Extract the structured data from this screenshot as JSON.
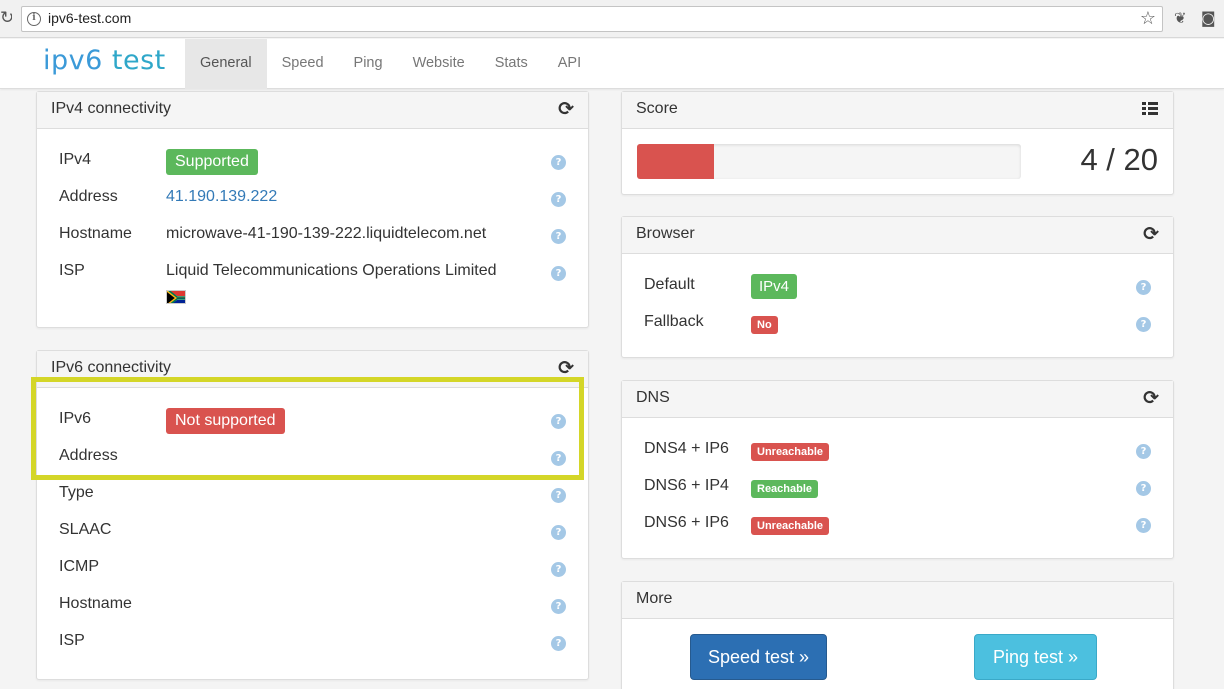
{
  "browser": {
    "url": "ipv6-test.com"
  },
  "site": {
    "logo_part1": "ipv6",
    "logo_part2": "test",
    "tabs": [
      {
        "label": "General",
        "active": true
      },
      {
        "label": "Speed",
        "active": false
      },
      {
        "label": "Ping",
        "active": false
      },
      {
        "label": "Website",
        "active": false
      },
      {
        "label": "Stats",
        "active": false
      },
      {
        "label": "API",
        "active": false
      }
    ]
  },
  "ipv4": {
    "title": "IPv4 connectivity",
    "rows": [
      {
        "label": "IPv4",
        "value": "Supported",
        "status": "green"
      },
      {
        "label": "Address",
        "value": "41.190.139.222"
      },
      {
        "label": "Hostname",
        "value": "microwave-41-190-139-222.liquidtelecom.net"
      },
      {
        "label": "ISP",
        "value": "Liquid Telecommunications Operations Limited"
      }
    ]
  },
  "ipv6": {
    "title": "IPv6 connectivity",
    "rows": [
      {
        "label": "IPv6",
        "value": "Not supported",
        "status": "red"
      },
      {
        "label": "Address",
        "value": ""
      },
      {
        "label": "Type",
        "value": ""
      },
      {
        "label": "SLAAC",
        "value": ""
      },
      {
        "label": "ICMP",
        "value": ""
      },
      {
        "label": "Hostname",
        "value": ""
      },
      {
        "label": "ISP",
        "value": ""
      }
    ]
  },
  "score": {
    "title": "Score",
    "text": "4 / 20",
    "value": 4,
    "max": 20
  },
  "browser_panel": {
    "title": "Browser",
    "rows": [
      {
        "label": "Default",
        "value": "IPv4",
        "status": "green"
      },
      {
        "label": "Fallback",
        "value": "No",
        "status": "red"
      }
    ]
  },
  "dns": {
    "title": "DNS",
    "rows": [
      {
        "label": "DNS4 + IP6",
        "value": "Unreachable",
        "status": "red"
      },
      {
        "label": "DNS6 + IP4",
        "value": "Reachable",
        "status": "green"
      },
      {
        "label": "DNS6 + IP6",
        "value": "Unreachable",
        "status": "red"
      }
    ]
  },
  "more": {
    "title": "More",
    "speed_button": "Speed test »",
    "ping_button": "Ping test »"
  },
  "icons": {
    "help": "?",
    "refresh": "⟳",
    "star": "☆"
  },
  "colors": {
    "success": "#5cb85c",
    "danger": "#d9534f",
    "highlight": "#d4d628"
  }
}
